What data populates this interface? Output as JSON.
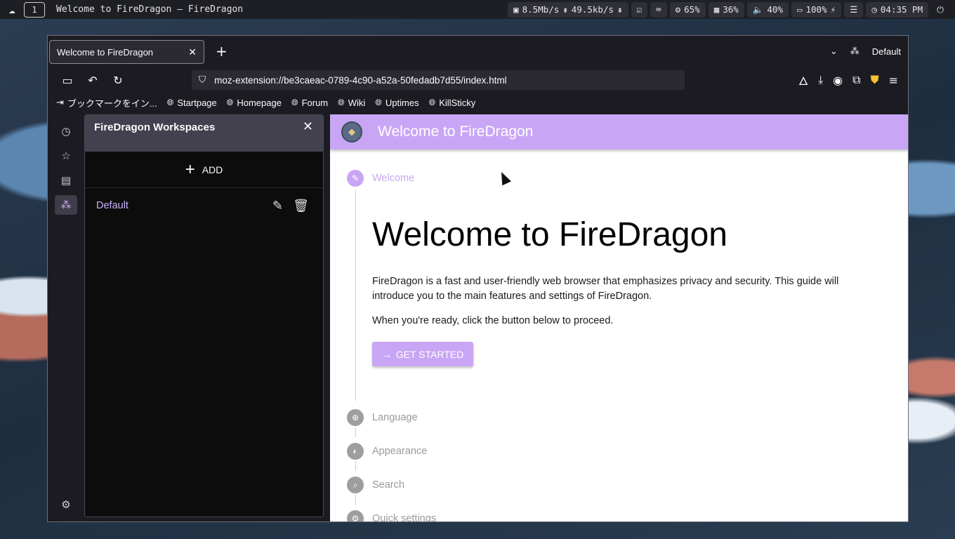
{
  "topbar": {
    "workspace": "1",
    "window_title": "Welcome to FireDragon — FireDragon",
    "net_down": "8.5Mb/s",
    "net_up": "49.5kb/s",
    "cpu": "65%",
    "memory": "36%",
    "volume": "40%",
    "battery": "100%",
    "clock": "04:35 PM"
  },
  "tabs": [
    {
      "title": "Welcome to FireDragon"
    }
  ],
  "tabstrip": {
    "workspace_label": "Default"
  },
  "urlbar": {
    "url": "moz-extension://be3caeac-0789-4c90-a52a-50fedadb7d55/index.html"
  },
  "bookmarks": {
    "import": "ブックマークをイン...",
    "items": [
      "Startpage",
      "Homepage",
      "Forum",
      "Wiki",
      "Uptimes",
      "KillSticky"
    ]
  },
  "panel": {
    "title": "FireDragon Workspaces",
    "add_label": "ADD",
    "workspaces": [
      "Default"
    ]
  },
  "page": {
    "header_title": "Welcome to FireDragon",
    "steps": [
      "Welcome",
      "Language",
      "Appearance",
      "Search",
      "Quick settings"
    ],
    "heading": "Welcome to FireDragon",
    "description": "FireDragon is a fast and user-friendly web browser that emphasizes privacy and security. This guide will introduce you to the main features and settings of FireDragon.",
    "proceed_text": "When you're ready, click the button below to proceed.",
    "get_started": "GET STARTED"
  },
  "colors": {
    "accent": "#c9a6f5",
    "panel_bg": "#0c0c0d",
    "browser_bg": "#1c1b22"
  }
}
